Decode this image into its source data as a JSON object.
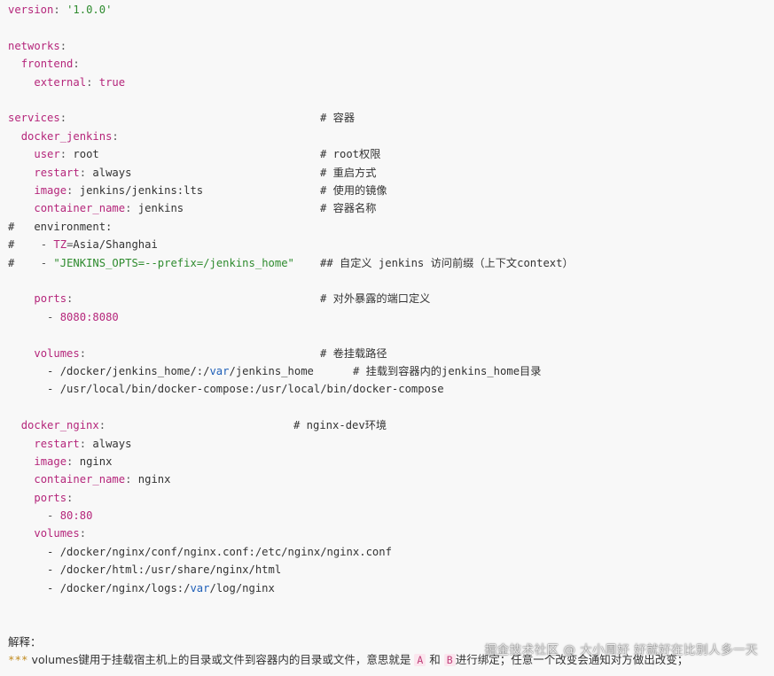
{
  "code": {
    "version_key": "version",
    "version_val": "'1.0.0'",
    "networks_key": "networks",
    "frontend_key": "frontend",
    "external_key": "external",
    "external_val": "true",
    "services_key": "services",
    "services_comment": "# 容器",
    "jenkins_key": "docker_jenkins",
    "user_key": "user",
    "user_val": "root",
    "user_comment": "# root权限",
    "restart_key": "restart",
    "restart_val": "always",
    "restart_comment": "# 重启方式",
    "image_key": "image",
    "image_val": "jenkins/jenkins:lts",
    "image_comment": "# 使用的镜像",
    "cname_key": "container_name",
    "cname_val": "jenkins",
    "cname_comment": "# 容器名称",
    "env_line": "#   environment:",
    "tz_hash": "#",
    "tz_dash": "- ",
    "tz_key": "TZ",
    "tz_eq": "=",
    "tz_val": "Asia/Shanghai",
    "opts_hash": "#",
    "opts_dash": "- ",
    "opts_val": "\"JENKINS_OPTS=--prefix=/jenkins_home\"",
    "opts_comment": "## 自定义 jenkins 访问前缀（上下文context）",
    "ports_key": "ports",
    "ports_comment": "# 对外暴露的端口定义",
    "ports_dash": "- ",
    "ports_val": "8080:8080",
    "volumes_key": "volumes",
    "volumes_comment": "# 卷挂载路径",
    "vol1_a": "- /docker/jenkins_home/:/",
    "vol1_var": "var",
    "vol1_b": "/jenkins_home",
    "vol1_comment": "# 挂载到容器内的jenkins_home目录",
    "vol2": "- /usr/local/bin/docker-compose:/usr/local/bin/docker-compose",
    "nginx_key": "docker_nginx",
    "nginx_comment": "# nginx-dev环境",
    "n_restart_key": "restart",
    "n_restart_val": "always",
    "n_image_key": "image",
    "n_image_val": "nginx",
    "n_cname_key": "container_name",
    "n_cname_val": "nginx",
    "n_ports_key": "ports",
    "n_ports_dash": "- ",
    "n_ports_val": "80:80",
    "n_volumes_key": "volumes",
    "n_vol1": "- /docker/nginx/conf/nginx.conf:/etc/nginx/nginx.conf",
    "n_vol2": "- /docker/html:/usr/share/nginx/html",
    "n_vol3_a": "- /docker/nginx/logs:/",
    "n_vol3_var": "var",
    "n_vol3_b": "/log/nginx"
  },
  "note": {
    "heading": "解释：",
    "stars": "***",
    "text_a": " volumes键用于挂载宿主机上的目录或文件到容器内的目录或文件，意思就是 ",
    "A": "A",
    "text_b": " 和 ",
    "B": "B",
    "text_c": "进行绑定；任意一个改变会通知对方做出改变；"
  },
  "watermark": "掘金技术社区 @ 大小周好 好就好在比别人多一天"
}
